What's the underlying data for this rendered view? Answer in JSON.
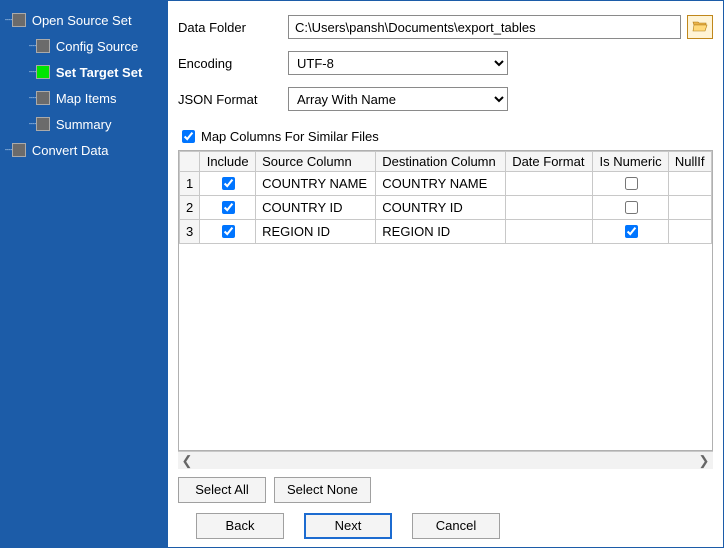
{
  "sidebar": {
    "items": [
      {
        "label": "Open Source Set",
        "level": 0,
        "active": false,
        "bold": false
      },
      {
        "label": "Config Source",
        "level": 1,
        "active": false,
        "bold": false
      },
      {
        "label": "Set Target Set",
        "level": 1,
        "active": true,
        "bold": true
      },
      {
        "label": "Map Items",
        "level": 1,
        "active": false,
        "bold": false
      },
      {
        "label": "Summary",
        "level": 1,
        "active": false,
        "bold": false
      },
      {
        "label": "Convert Data",
        "level": 0,
        "active": false,
        "bold": false
      }
    ]
  },
  "form": {
    "data_folder_label": "Data Folder",
    "data_folder_value": "C:\\Users\\pansh\\Documents\\export_tables",
    "encoding_label": "Encoding",
    "encoding_value": "UTF-8",
    "json_format_label": "JSON Format",
    "json_format_value": "Array With Name",
    "map_similar_label": "Map Columns For Similar Files",
    "map_similar_checked": true
  },
  "table": {
    "headers": {
      "include": "Include",
      "source": "Source Column",
      "dest": "Destination Column",
      "dateformat": "Date Format",
      "isnumeric": "Is Numeric",
      "nullif": "NullIf"
    },
    "rows": [
      {
        "n": "1",
        "include": true,
        "source": "COUNTRY NAME",
        "dest": "COUNTRY NAME",
        "dateformat": "",
        "isnumeric": false,
        "nullif": ""
      },
      {
        "n": "2",
        "include": true,
        "source": "COUNTRY ID",
        "dest": "COUNTRY ID",
        "dateformat": "",
        "isnumeric": false,
        "nullif": ""
      },
      {
        "n": "3",
        "include": true,
        "source": "REGION ID",
        "dest": "REGION ID",
        "dateformat": "",
        "isnumeric": true,
        "nullif": ""
      }
    ]
  },
  "buttons": {
    "select_all": "Select All",
    "select_none": "Select None",
    "back": "Back",
    "next": "Next",
    "cancel": "Cancel"
  }
}
